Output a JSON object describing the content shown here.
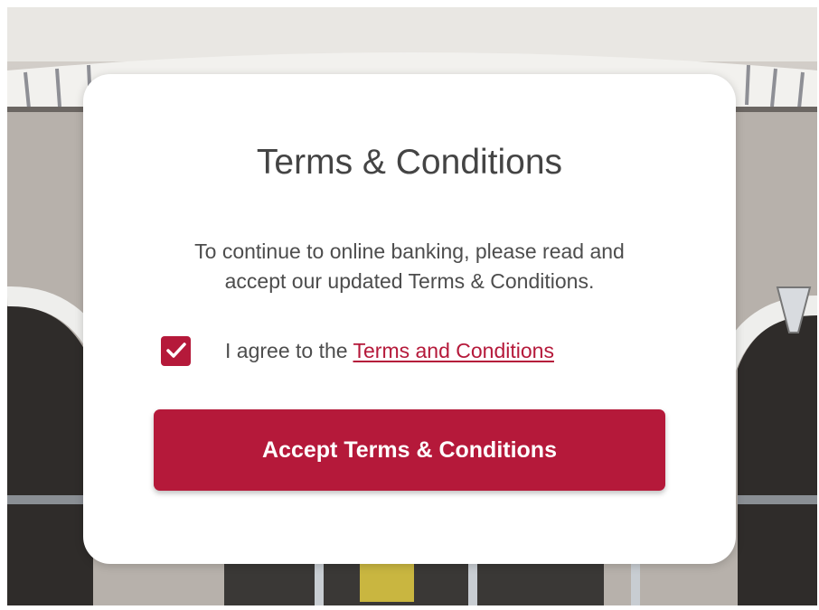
{
  "modal": {
    "title": "Terms & Conditions",
    "body_line1": "To continue to online banking, please read and",
    "body_line2": "accept our updated Terms & Conditions.",
    "agree_prefix": "I agree to the ",
    "agree_link": "Terms and Conditions",
    "agree_checked": true,
    "accept_button_label": "Accept Terms & Conditions"
  },
  "colors": {
    "brand": "#b5193a",
    "modal_background": "#ffffff",
    "text": "#4d4d4d"
  },
  "icons": {
    "checkbox": "checkmark-icon"
  }
}
